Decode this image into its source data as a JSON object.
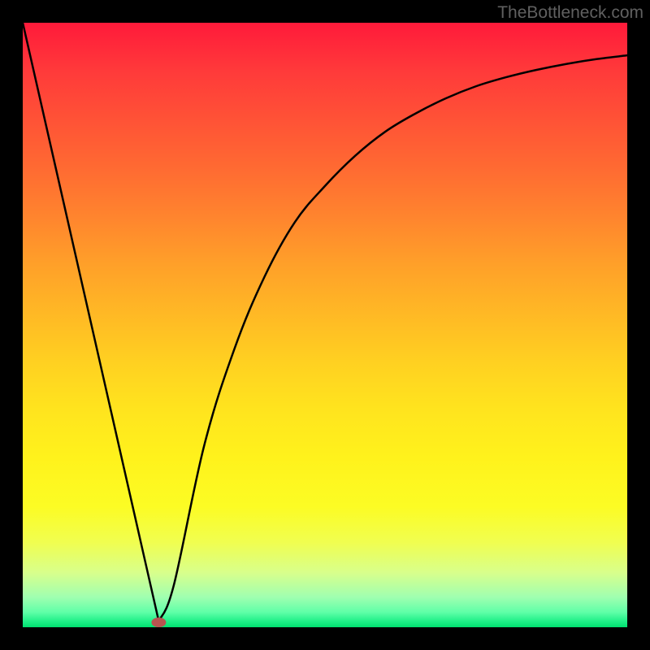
{
  "watermark": "TheBottleneck.com",
  "chart_data": {
    "type": "line",
    "title": "",
    "xlabel": "",
    "ylabel": "",
    "xlim": [
      0,
      100
    ],
    "ylim": [
      0,
      100
    ],
    "gradient_background": true,
    "gradient_stops": [
      {
        "pos": 0,
        "color": "#ff1a3a"
      },
      {
        "pos": 50,
        "color": "#ffc423"
      },
      {
        "pos": 80,
        "color": "#fcfc24"
      },
      {
        "pos": 100,
        "color": "#00e070"
      }
    ],
    "series": [
      {
        "name": "bottleneck-curve",
        "color": "#000000",
        "x": [
          0,
          5,
          10,
          15,
          20,
          22.5,
          25,
          30,
          35,
          40,
          45,
          50,
          55,
          60,
          65,
          70,
          75,
          80,
          85,
          90,
          95,
          100
        ],
        "y": [
          100,
          78,
          56,
          34,
          12,
          1,
          7,
          30,
          46,
          58,
          67,
          73,
          78,
          82,
          85,
          87.5,
          89.5,
          91,
          92.2,
          93.2,
          94,
          94.6
        ]
      }
    ],
    "marker": {
      "x": 22.5,
      "y": 0.8,
      "shape": "ellipse",
      "color": "#b85450"
    }
  }
}
